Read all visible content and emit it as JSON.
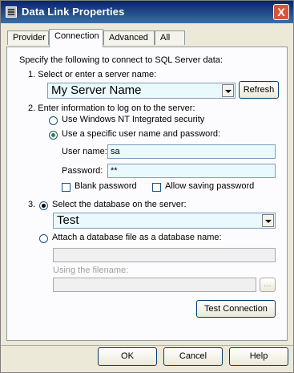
{
  "window": {
    "title": "Data Link Properties",
    "close_label": "X"
  },
  "tabs": [
    {
      "label": "Provider",
      "active": false
    },
    {
      "label": "Connection",
      "active": true
    },
    {
      "label": "Advanced",
      "active": false
    },
    {
      "label": "All",
      "active": false
    }
  ],
  "connection": {
    "intro": "Specify the following to connect to SQL Server data:",
    "step1": {
      "label": "1. Select or enter a server name:",
      "server_name": "My Server Name",
      "refresh_label": "Refresh"
    },
    "step2": {
      "label": "2. Enter information to log on to the server:",
      "nt_security_label": "Use Windows NT Integrated security",
      "specific_label": "Use a specific user name and password:",
      "username_label": "User name:",
      "username_value": "sa",
      "password_label": "Password:",
      "password_value": "**",
      "blank_password_label": "Blank password",
      "allow_saving_label": "Allow saving password",
      "nt_selected": false,
      "specific_selected": true,
      "blank_password_checked": false,
      "allow_saving_checked": false
    },
    "step3": {
      "number": "3.",
      "select_db_label": "Select the database on the server:",
      "database_value": "Test",
      "attach_label": "Attach a database file as a database name:",
      "attach_name_value": "",
      "filename_label": "Using the filename:",
      "filename_value": "",
      "browse_label": "...",
      "select_db_selected": true,
      "attach_selected": false
    },
    "test_connection_label": "Test Connection"
  },
  "footer": {
    "ok_label": "OK",
    "cancel_label": "Cancel",
    "help_label": "Help"
  },
  "colors": {
    "field_bg": "#eaf9fb",
    "titlebar_start": "#0a246a",
    "titlebar_end": "#3a6ea5",
    "dialog_bg": "#ece9d8"
  }
}
